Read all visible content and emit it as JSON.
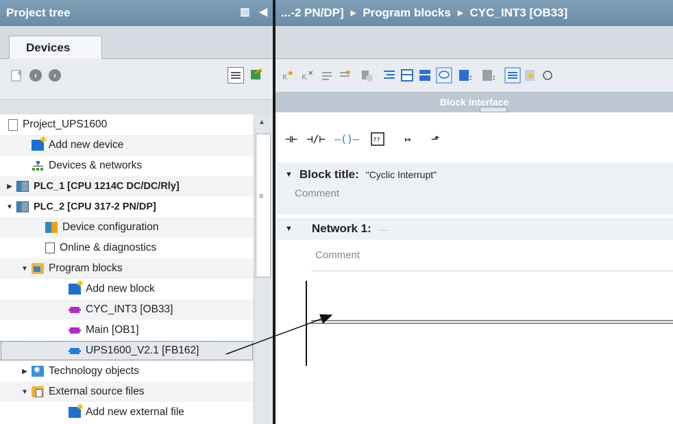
{
  "left": {
    "title": "Project tree",
    "tab": "Devices",
    "tree": [
      {
        "label": "Project_UPS1600",
        "icon": "project-icon",
        "depth": 0,
        "twisty": ""
      },
      {
        "label": "Add new device",
        "icon": "add-device-icon",
        "depth": 1,
        "twisty": ""
      },
      {
        "label": "Devices & networks",
        "icon": "network-icon",
        "depth": 1,
        "twisty": ""
      },
      {
        "label": "PLC_1 [CPU 1214C DC/DC/Rly]",
        "icon": "plc-icon",
        "depth": 0,
        "twisty": "▶",
        "bold": true
      },
      {
        "label": "PLC_2 [CPU 317-2 PN/DP]",
        "icon": "plc-icon",
        "depth": 0,
        "twisty": "▼",
        "bold": true
      },
      {
        "label": "Device configuration",
        "icon": "device-config-icon",
        "depth": 2,
        "twisty": ""
      },
      {
        "label": "Online & diagnostics",
        "icon": "diagnostics-icon",
        "depth": 2,
        "twisty": ""
      },
      {
        "label": "Program blocks",
        "icon": "folder-icon",
        "depth": 1,
        "twisty": "▼"
      },
      {
        "label": "Add new block",
        "icon": "add-block-icon",
        "depth": 3,
        "twisty": ""
      },
      {
        "label": "CYC_INT3 [OB33]",
        "icon": "ob-icon",
        "depth": 3,
        "twisty": ""
      },
      {
        "label": "Main [OB1]",
        "icon": "ob-icon",
        "depth": 3,
        "twisty": ""
      },
      {
        "label": "UPS1600_V2.1 [FB162]",
        "icon": "fb-icon",
        "depth": 3,
        "twisty": "",
        "selected": true
      },
      {
        "label": "Technology objects",
        "icon": "technology-icon",
        "depth": 1,
        "twisty": "▶"
      },
      {
        "label": "External source files",
        "icon": "external-folder-icon",
        "depth": 1,
        "twisty": "▼"
      },
      {
        "label": "Add new external file",
        "icon": "add-file-icon",
        "depth": 3,
        "twisty": ""
      }
    ]
  },
  "right": {
    "breadcrumb": [
      "...-2 PN/DP]",
      "Program blocks",
      "CYC_INT3 [OB33]"
    ],
    "block_interface": "Block interface",
    "block_title_label": "Block title:",
    "block_title_value": "\"Cyclic Interrupt\"",
    "comment1": "Comment",
    "network_label": "Network 1:",
    "network_dots": ".....",
    "comment2": "Comment"
  }
}
